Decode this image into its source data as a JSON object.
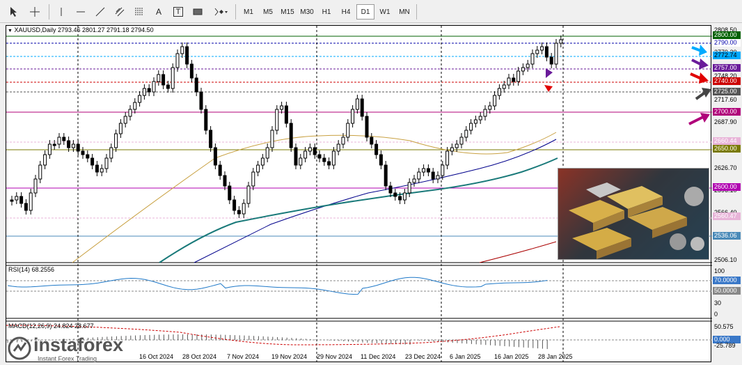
{
  "toolbar": {
    "timeframes": [
      "M1",
      "M5",
      "M15",
      "M30",
      "H1",
      "H4",
      "D1",
      "W1",
      "MN"
    ],
    "active_timeframe": "D1",
    "tools": {
      "text_tool": "A",
      "text_label_tool": "T"
    }
  },
  "chart": {
    "symbol_header": "XAUUSD,Daily  2793.46 2801.27 2791.18 2794.50",
    "price_axis": [
      "2808.50",
      "2779.20",
      "2748.20",
      "2717.60",
      "2687.90",
      "2626.70",
      "2596.10",
      "2566.40",
      "2506.10"
    ],
    "price_tags": [
      {
        "value": "2800.00",
        "bg": "#006000",
        "fg": "#ffffff"
      },
      {
        "value": "2790.00",
        "bg": "#ffffff",
        "fg": "#0000aa"
      },
      {
        "value": "2772.74",
        "bg": "#00aaff",
        "fg": "#000000"
      },
      {
        "value": "2757.00",
        "bg": "#6a1b9a",
        "fg": "#ffffff"
      },
      {
        "value": "2740.00",
        "bg": "#cc0000",
        "fg": "#ffffff"
      },
      {
        "value": "2725.00",
        "bg": "#555555",
        "fg": "#ffffff"
      },
      {
        "value": "2700.00",
        "bg": "#b0007a",
        "fg": "#ffffff"
      },
      {
        "value": "2660.44",
        "bg": "#e8b4d8",
        "fg": "#ffffff"
      },
      {
        "value": "2650.00",
        "bg": "#7a7a00",
        "fg": "#ffffff"
      },
      {
        "value": "2600.00",
        "bg": "#b000b0",
        "fg": "#ffffff"
      },
      {
        "value": "2560.47",
        "bg": "#e8b4d8",
        "fg": "#ffffff"
      },
      {
        "value": "2536.06",
        "bg": "#4a8ab8",
        "fg": "#ffffff"
      }
    ],
    "date_axis": [
      "16 Oct 2024",
      "28 Oct 2024",
      "7 Nov 2024",
      "19 Nov 2024",
      "29 Nov 2024",
      "11 Dec 2024",
      "23 Dec 2024",
      "6 Jan 2025",
      "16 Jan 2025",
      "28 Jan 2025"
    ],
    "rsi": {
      "label": "RSI(14) 68.2556",
      "levels": [
        "100",
        "70.0000",
        "50.0000",
        "30",
        "0"
      ]
    },
    "macd": {
      "label": "MACD(12,26,9) 24.824 28.677",
      "levels": [
        "50.575",
        "0.000",
        "-25.789"
      ]
    }
  },
  "branding": {
    "name": "instaforex",
    "tagline": "Instant Forex Trading"
  },
  "colors": {
    "accent": "#0000ff",
    "up": "#ffffff",
    "down": "#000000"
  }
}
